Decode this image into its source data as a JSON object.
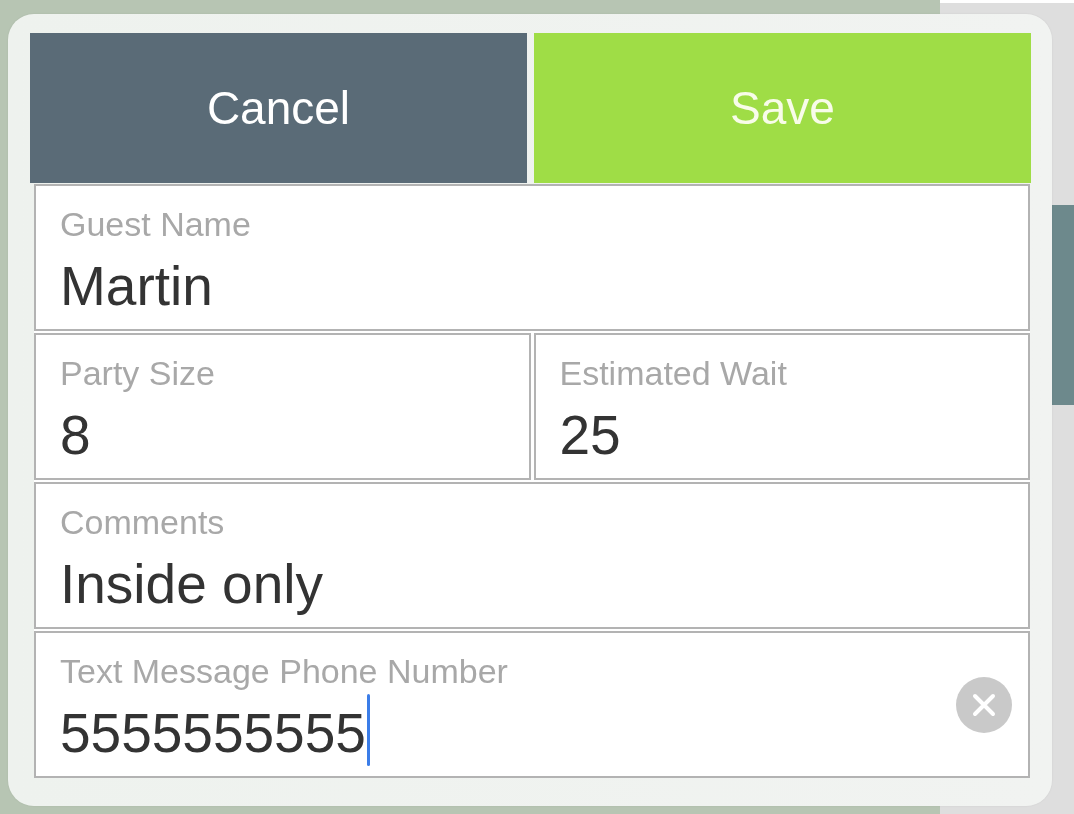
{
  "buttons": [
    {
      "label": "Cancel",
      "kind": "cancel"
    },
    {
      "label": "Save",
      "kind": "save"
    }
  ],
  "form": {
    "rows": [
      {
        "fields": [
          {
            "label": "Guest Name",
            "value": "Martin",
            "focused": false
          }
        ]
      },
      {
        "fields": [
          {
            "label": "Party Size",
            "value": "8",
            "focused": false
          },
          {
            "label": "Estimated Wait",
            "value": "25",
            "focused": false
          }
        ]
      },
      {
        "fields": [
          {
            "label": "Comments",
            "value": "Inside only",
            "focused": false
          }
        ]
      },
      {
        "fields": [
          {
            "label": "Text Message Phone Number",
            "value": "5555555555",
            "focused": true
          }
        ]
      }
    ]
  }
}
